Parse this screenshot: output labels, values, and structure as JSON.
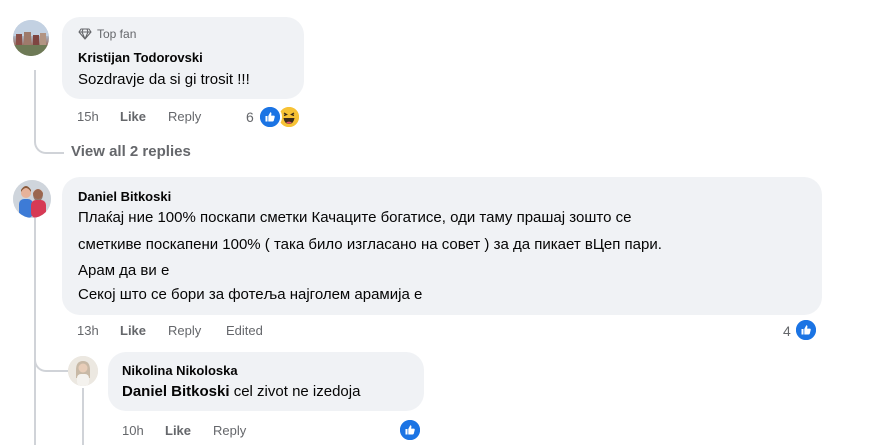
{
  "comment1": {
    "badge": "Top fan",
    "author": "Kristijan Todorovski",
    "text": "Sozdravje da si gi trosit !!!",
    "time": "15h",
    "like": "Like",
    "reply": "Reply",
    "reaction_count": "6",
    "reactions": [
      "like-icon",
      "haha-icon"
    ],
    "view_replies": "View all 2 replies"
  },
  "comment2": {
    "author": "Daniel Bitkoski",
    "lines": [
      "Плаќај ние 100% поскапи сметки Качаците богатисе, оди таму прашај зошто се",
      "сметкиве поскапени 100% ( така било изгласано на совет ) за да пикает вЦеп пари.",
      "Арам да ви е",
      "Секој што се бори за фотеља најголем арамија е"
    ],
    "time": "13h",
    "like": "Like",
    "reply": "Reply",
    "edited": "Edited",
    "reaction_count": "4",
    "reactions": [
      "like-icon"
    ]
  },
  "reply1": {
    "author": "Nikolina Nikoloska",
    "mention": "Daniel Bitkoski",
    "text": " cel zivot ne izedoja",
    "time": "10h",
    "like": "Like",
    "reply": "Reply",
    "reactions": [
      "like-icon"
    ]
  },
  "colors": {
    "bubble": "#f0f2f5",
    "meta_text": "#65676b",
    "like_blue": "#1b74e4",
    "haha_yellow": "#f7c235"
  }
}
